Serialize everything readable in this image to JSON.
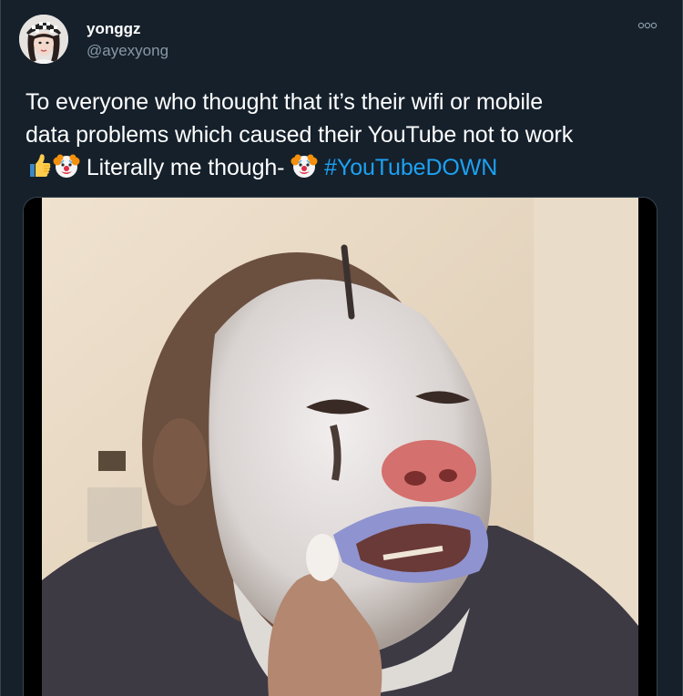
{
  "user": {
    "display_name": "yonggz",
    "handle": "@ayexyong",
    "avatar_icon": "profile-avatar"
  },
  "more_icon": "more-horizontal-icon",
  "tweet": {
    "text_line1": "To everyone who thought that it’s their wifi or mobile",
    "text_line2": "data problems which caused their YouTube not to work",
    "text_line3_middle": " Literally me though- ",
    "hashtag": "#YouTubeDOWN",
    "emojis": [
      "thumbs-up-icon",
      "clown-face-icon"
    ]
  },
  "media": {
    "type": "photo",
    "description_icon": "clown-makeup-photo"
  },
  "colors": {
    "background": "#15202b",
    "text": "#ffffff",
    "secondary": "#8899a6",
    "link": "#1da1f2",
    "border": "#38444d"
  }
}
